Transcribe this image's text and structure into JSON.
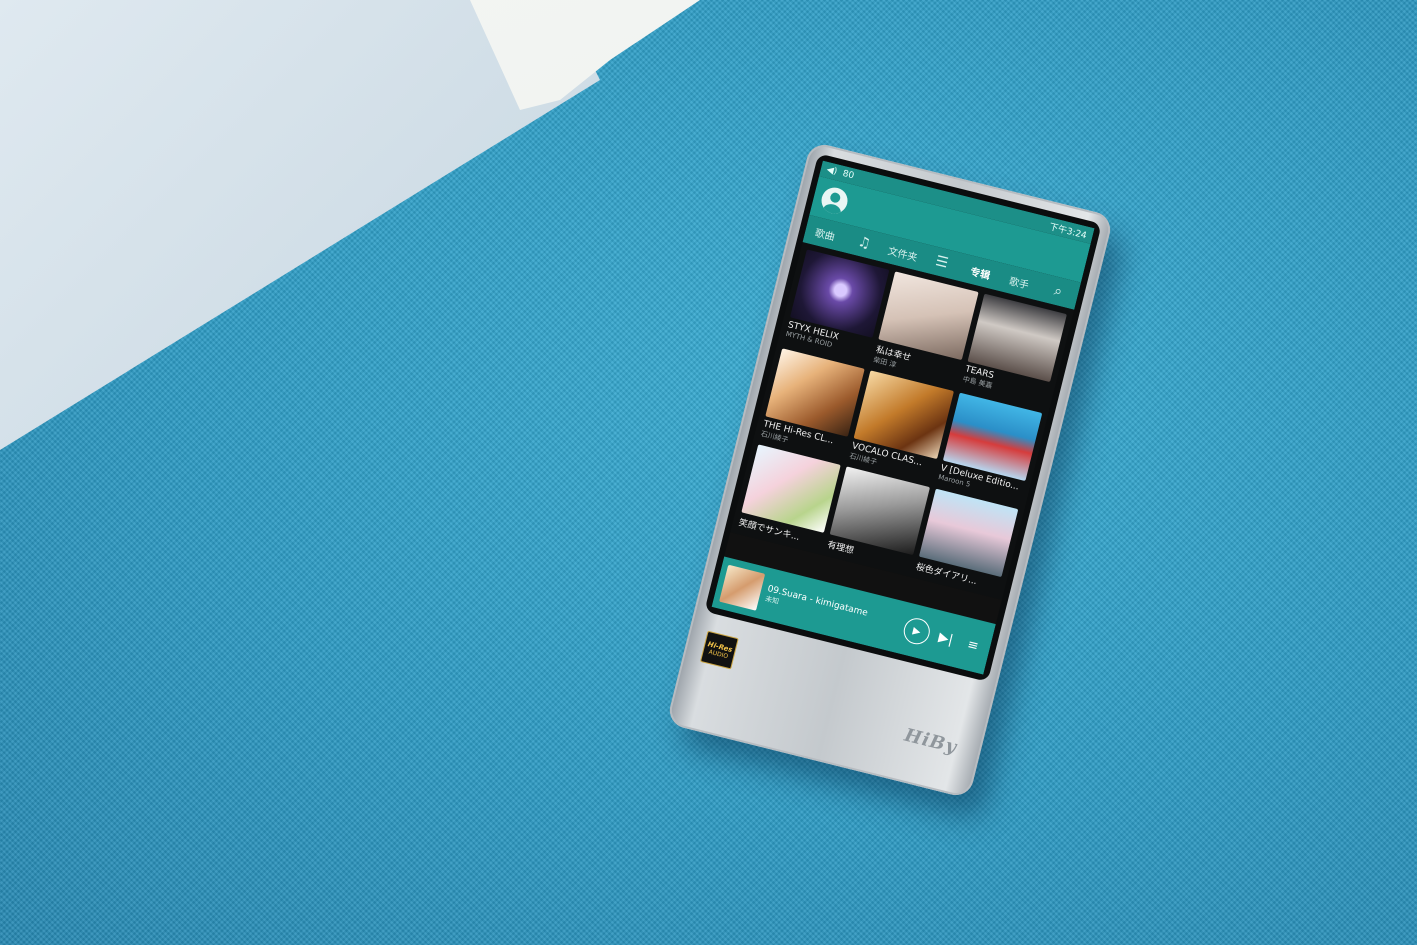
{
  "status": {
    "volume": "80",
    "time": "下午3:24"
  },
  "tabs": [
    {
      "label": "歌曲"
    },
    {
      "label": "文件夹"
    },
    {
      "label": "专辑"
    },
    {
      "label": "歌手"
    }
  ],
  "icons": {
    "music": "♫",
    "playlist": "☰",
    "search": "⌕"
  },
  "albums": [
    {
      "title": "STYX HELIX",
      "artist": "MYTH & ROID"
    },
    {
      "title": "私は幸せ",
      "artist": "柴田 淳"
    },
    {
      "title": "TEARS",
      "artist": "中島 美嘉"
    },
    {
      "title": "THE Hi-Res CL...",
      "artist": "石川綾子"
    },
    {
      "title": "VOCALO CLAS...",
      "artist": "石川綾子"
    },
    {
      "title": "V [Deluxe Editio...",
      "artist": "Maroon 5"
    },
    {
      "title": "笑顔でサンキ...",
      "artist": ""
    },
    {
      "title": "有理想",
      "artist": ""
    },
    {
      "title": "桜色ダイアリ...",
      "artist": ""
    }
  ],
  "now_playing": {
    "title": "09.Suara - kimigatame",
    "artist": "未知"
  },
  "badge": {
    "line1": "Hi-Res",
    "line2": "AUDIO"
  },
  "brand": "HiBy"
}
